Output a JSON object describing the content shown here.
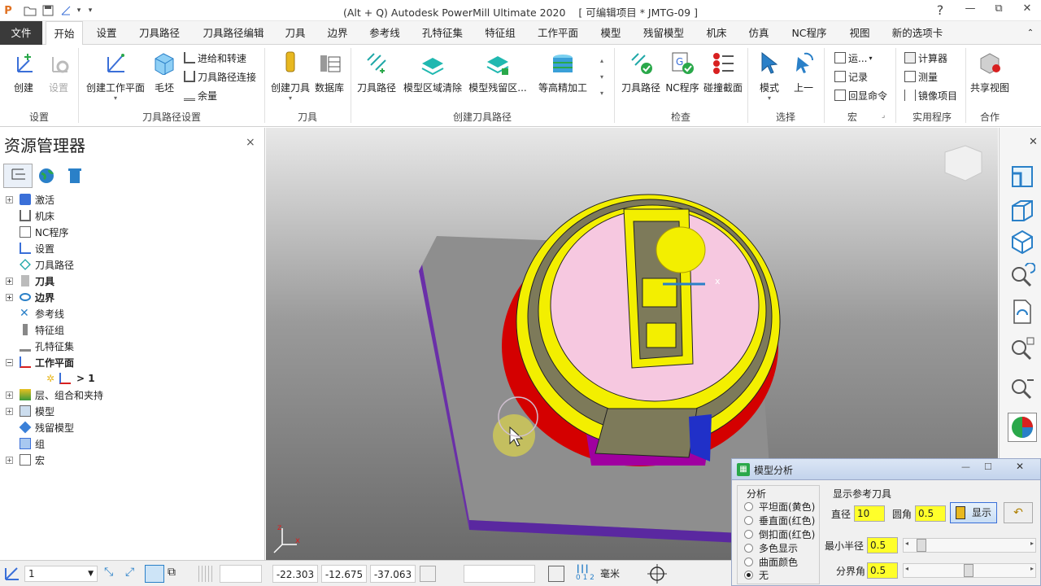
{
  "titlebar": {
    "title": "(Alt + Q) Autodesk PowerMill Ultimate 2020",
    "project": "[ 可编辑项目 * JMTG-09 ]",
    "help": "?",
    "minimize": "—",
    "restore": "⧉",
    "close": "✕"
  },
  "tabs": [
    "文件",
    "开始",
    "设置",
    "刀具路径",
    "刀具路径编辑",
    "刀具",
    "边界",
    "参考线",
    "孔特征集",
    "特征组",
    "工作平面",
    "模型",
    "残留模型",
    "机床",
    "仿真",
    "NC程序",
    "视图",
    "新的选项卡"
  ],
  "ribbon": {
    "create": "创建",
    "settings": "设置",
    "group_setup": "设置",
    "create_workplane": "创建工作平面",
    "blank": "毛坯",
    "feed_rate": "进给和转速",
    "toolpath_connect": "刀具路径连接",
    "allowance": "余量",
    "group_toolpath_setup": "刀具路径设置",
    "create_tool": "创建刀具",
    "database": "数据库",
    "group_tool": "刀具",
    "toolpaths": "刀具路径",
    "model_area_clear": "模型区域清除",
    "model_rest": "模型残留区...",
    "constant_z": "等高精加工",
    "group_create_toolpath": "创建刀具路径",
    "check_toolpath": "刀具路径",
    "check_nc": "NC程序",
    "collision": "碰撞截面",
    "group_check": "检查",
    "mode": "模式",
    "previous": "上一",
    "group_select": "选择",
    "run": "运...",
    "record": "记录",
    "echo": "回显命令",
    "group_macro": "宏",
    "calculator": "计算器",
    "measure": "测量",
    "mirror": "镜像项目",
    "group_utility": "实用程序",
    "share_view": "共享视图",
    "group_collab": "合作"
  },
  "explorer": {
    "title": "资源管理器",
    "close": "×",
    "items": [
      {
        "label": "激活",
        "bold": false
      },
      {
        "label": "机床",
        "bold": false
      },
      {
        "label": "NC程序",
        "bold": false
      },
      {
        "label": "设置",
        "bold": false
      },
      {
        "label": "刀具路径",
        "bold": false
      },
      {
        "label": "刀具",
        "bold": true
      },
      {
        "label": "边界",
        "bold": true
      },
      {
        "label": "参考线",
        "bold": false
      },
      {
        "label": "特征组",
        "bold": false
      },
      {
        "label": "孔特征集",
        "bold": false
      },
      {
        "label": "工作平面",
        "bold": true
      },
      {
        "label": "> 1",
        "bold": true
      },
      {
        "label": "层、组合和夹持",
        "bold": false
      },
      {
        "label": "模型",
        "bold": false
      },
      {
        "label": "残留模型",
        "bold": false
      },
      {
        "label": "组",
        "bold": false
      },
      {
        "label": "宏",
        "bold": false
      }
    ]
  },
  "status": {
    "workplane": "1",
    "x": "-22.303",
    "y": "-12.675",
    "z": "-37.063",
    "units": "毫米"
  },
  "dialog": {
    "title": "模型分析",
    "analysis_label": "分析",
    "options": [
      "平坦面(黄色)",
      "垂直面(红色)",
      "倒扣面(红色)",
      "多色显示",
      "曲面颜色",
      "无"
    ],
    "selected": "无",
    "ref_tool_label": "显示参考刀具",
    "diameter_label": "直径",
    "diameter": "10",
    "corner_label": "圆角",
    "corner": "0.5",
    "show_button": "显示",
    "min_radius_label": "最小半径",
    "min_radius": "0.5",
    "boundary_angle_label": "分界角",
    "boundary_angle": "0.5"
  },
  "colors": {
    "flat": "#f3ef00",
    "vertical": "#d40000",
    "base": "#6a2fa8",
    "top": "#f6c8e0"
  }
}
